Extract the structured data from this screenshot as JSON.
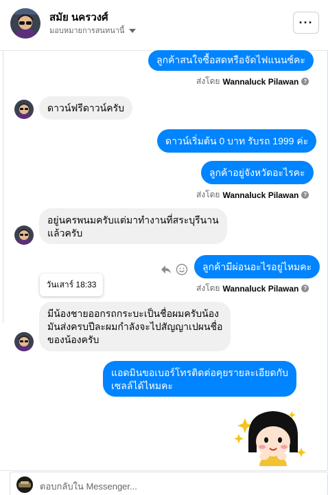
{
  "header": {
    "name": "สมัย นครวงศ์",
    "subtitle": "มอบหมายการสนทนานี้"
  },
  "messages": [
    {
      "dir": "out",
      "text": "ลูกค้าสนใจซื้อสดหรือจัดไฟแนนซ์คะ"
    },
    {
      "dir": "in",
      "text": "ดาวน์ฟรีดาวน์ครับ"
    },
    {
      "dir": "out",
      "text": "ดาวน์เริ่มต้น 0 บาท รับรถ 1999 ค่ะ"
    },
    {
      "dir": "out",
      "text": "ลูกค้าอยู่จังหวัดอะไรคะ"
    },
    {
      "dir": "in",
      "lines": [
        "อยู่นครพนมครับแต่มาทำงานที่สระบุรีนาน",
        "แล้วครับ"
      ]
    },
    {
      "dir": "out",
      "text": "ลูกค้ามีผ่อนอะไรอยู่ไหมคะ"
    },
    {
      "dir": "in",
      "lines": [
        "มีน้องชายออกรถกระบะเป็นชื่อผมครับน้อง",
        "มันส่งครบปีละผมกำลังจะไปสัญญาเปผนชื่อ",
        "ของน้องครับ"
      ]
    },
    {
      "dir": "out",
      "lines": [
        "แอดมินขอเบอร์โทรติดต่อคุยรายละเอียดกับ",
        "เซลล์ได้ไหมคะ"
      ]
    }
  ],
  "sent_by": {
    "prefix": "ส่งโดย",
    "name": "Wannaluck Pilawan"
  },
  "timestamp": "วันเสาร์ 18:33",
  "composer": {
    "placeholder": "ตอบกลับใน Messenger..."
  },
  "icons": [
    "more-icon",
    "chevron-down-icon",
    "info-icon",
    "reply-icon",
    "smile-icon",
    "sticker"
  ],
  "colors": {
    "outgoing": "#0084ff",
    "incoming": "#f0f0f0"
  }
}
